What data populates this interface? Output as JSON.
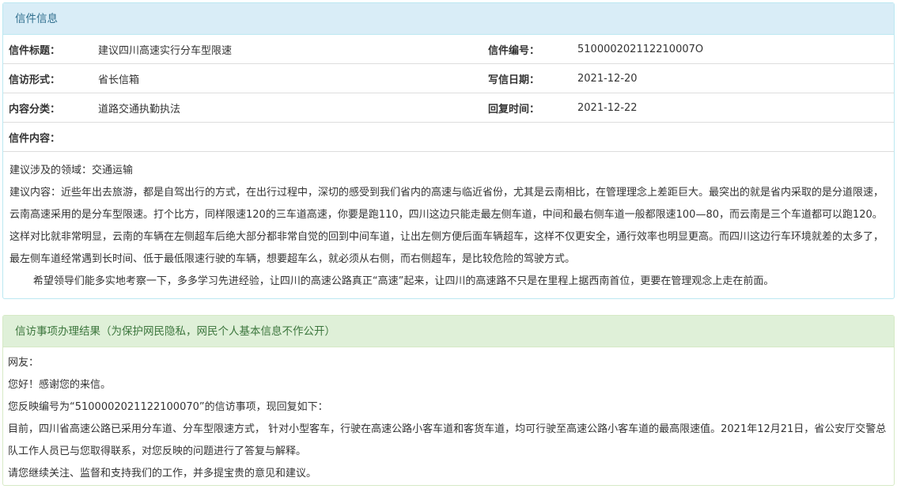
{
  "letter": {
    "heading": "信件信息",
    "title_label": "信件标题：",
    "title_value": "建议四川高速实行分车型限速",
    "number_label": "信件编号：",
    "number_value": "510000202112210007O",
    "form_label": "信访形式：",
    "form_value": "省长信箱",
    "date_label": "写信日期：",
    "date_value": "2021-12-20",
    "category_label": "内容分类：",
    "category_value": "道路交通执勤执法",
    "reply_time_label": "回复时间：",
    "reply_time_value": "2021-12-22",
    "content_label": "信件内容：",
    "content_paragraphs": [
      "建议涉及的领域：交通运输",
      "建议内容：近些年出去旅游，都是自驾出行的方式，在出行过程中，深切的感受到我们省内的高速与临近省份，尤其是云南相比，在管理理念上差距巨大。最突出的就是省内采取的是分道限速，云南高速采用的是分车型限速。打个比方，同样限速120的三车道高速，你要是跑110，四川这边只能走最左侧车道，中间和最右侧车道一般都限速100—80，而云南是三个车道都可以跑120。这样对比就非常明显，云南的车辆在左侧超车后绝大部分都非常自觉的回到中间车道，让出左侧方便后面车辆超车，这样不仅更安全，通行效率也明显更高。而四川这边行车环境就差的太多了，最左侧车道经常遇到长时间、低于最低限速行驶的车辆，想要超车么，就必须从右侧，而右侧超车，是比较危险的驾驶方式。"
    ],
    "content_closing": "希望领导们能多实地考察一下，多多学习先进经验，让四川的高速公路真正“高速”起来，让四川的高速路不只是在里程上据西南首位，更要在管理观念上走在前面。"
  },
  "reply": {
    "heading": "信访事项办理结果（为保护网民隐私，网民个人基本信息不作公开）",
    "lines": [
      "网友：",
      "您好！感谢您的来信。",
      "您反映编号为“5100002021122100070”的信访事项，现回复如下：",
      "目前，四川省高速公路已采用分车道、分车型限速方式， 针对小型客车，行驶在高速公路小客车道和客货车道，均可行驶至高速公路小客车道的最高限速值。2021年12月21日，省公安厅交警总队工作人员已与您取得联系，对您反映的问题进行了答复与解释。",
      "请您继续关注、监督和支持我们的工作，并多提宝贵的意见和建议。"
    ]
  },
  "colors": {
    "info_heading_bg": "#d9edf7",
    "info_heading_text": "#31708f",
    "success_heading_bg": "#dff0d8",
    "success_heading_text": "#3c763d"
  }
}
